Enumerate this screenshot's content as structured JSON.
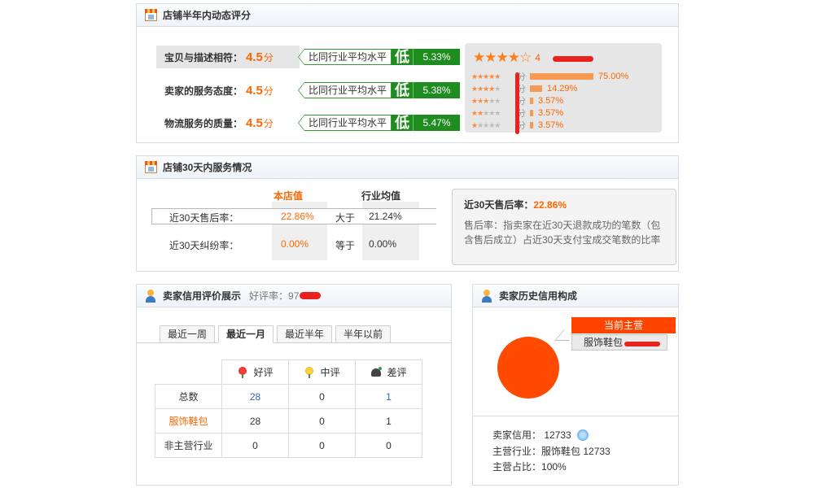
{
  "dynamic_score": {
    "title": "店铺半年内动态评分",
    "rows": [
      {
        "label": "宝贝与描述相符：",
        "score": "4.5",
        "unit": "分",
        "compare_label": "比同行业平均水平",
        "level": "低",
        "pct": "5.33%"
      },
      {
        "label": "卖家的服务态度：",
        "score": "4.5",
        "unit": "分",
        "compare_label": "比同行业平均水平",
        "level": "低",
        "pct": "5.38%"
      },
      {
        "label": "物流服务的质量：",
        "score": "4.5",
        "unit": "分",
        "compare_label": "比同行业平均水平",
        "level": "低",
        "pct": "5.47%"
      }
    ],
    "distribution": {
      "avg_prefix": "4",
      "rows": [
        {
          "stars": 5,
          "unit": "分",
          "pct": "75.00%",
          "fraction": 0.75
        },
        {
          "stars": 4,
          "unit": "分",
          "pct": "14.29%",
          "fraction": 0.1429
        },
        {
          "stars": 3,
          "unit": "分",
          "pct": "3.57%",
          "fraction": 0.0357
        },
        {
          "stars": 2,
          "unit": "分",
          "pct": "3.57%",
          "fraction": 0.0357
        },
        {
          "stars": 1,
          "unit": "分",
          "pct": "3.57%",
          "fraction": 0.0357
        }
      ]
    }
  },
  "service30": {
    "title": "店铺30天内服务情况",
    "col_store": "本店值",
    "col_industry": "行业均值",
    "rows": [
      {
        "label": "近30天售后率：",
        "store": "22.86%",
        "relation": "大于",
        "industry": "21.24%"
      },
      {
        "label": "近30天纠纷率：",
        "store": "0.00%",
        "relation": "等于",
        "industry": "0.00%"
      }
    ],
    "tip": {
      "title": "近30天售后率：",
      "value": "22.86%",
      "description": "售后率：指卖家在近30天退款成功的笔数（包含售后成立）占近30天支付宝成交笔数的比率"
    }
  },
  "credit": {
    "title": "卖家信用评价展示",
    "rating_label": "好评率：",
    "rating_value": "97",
    "tabs": [
      "最近一周",
      "最近一月",
      "最近半年",
      "半年以前"
    ],
    "active_tab": 1,
    "headers": [
      "好评",
      "中评",
      "差评"
    ],
    "rows": [
      {
        "label": "总数",
        "good": "28",
        "neutral": "0",
        "bad": "1"
      },
      {
        "label": "服饰鞋包",
        "good": "28",
        "neutral": "0",
        "bad": "1"
      },
      {
        "label": "非主营行业",
        "good": "0",
        "neutral": "0",
        "bad": "0"
      }
    ]
  },
  "history": {
    "title": "卖家历史信用构成",
    "current_main_label": "当前主营",
    "category": "服饰鞋包",
    "main_share": 1.0,
    "seller_credit_label": "卖家信用：",
    "seller_credit": "12733",
    "main_industry_label": "主营行业：",
    "main_industry": "服饰鞋包 12733",
    "main_share_label": "主营占比：",
    "main_share_text": "100%"
  },
  "colors": {
    "accent": "#ff6600",
    "green": "#1e8c1e",
    "pie": "#ff4a00",
    "redact": "#e8221f"
  }
}
